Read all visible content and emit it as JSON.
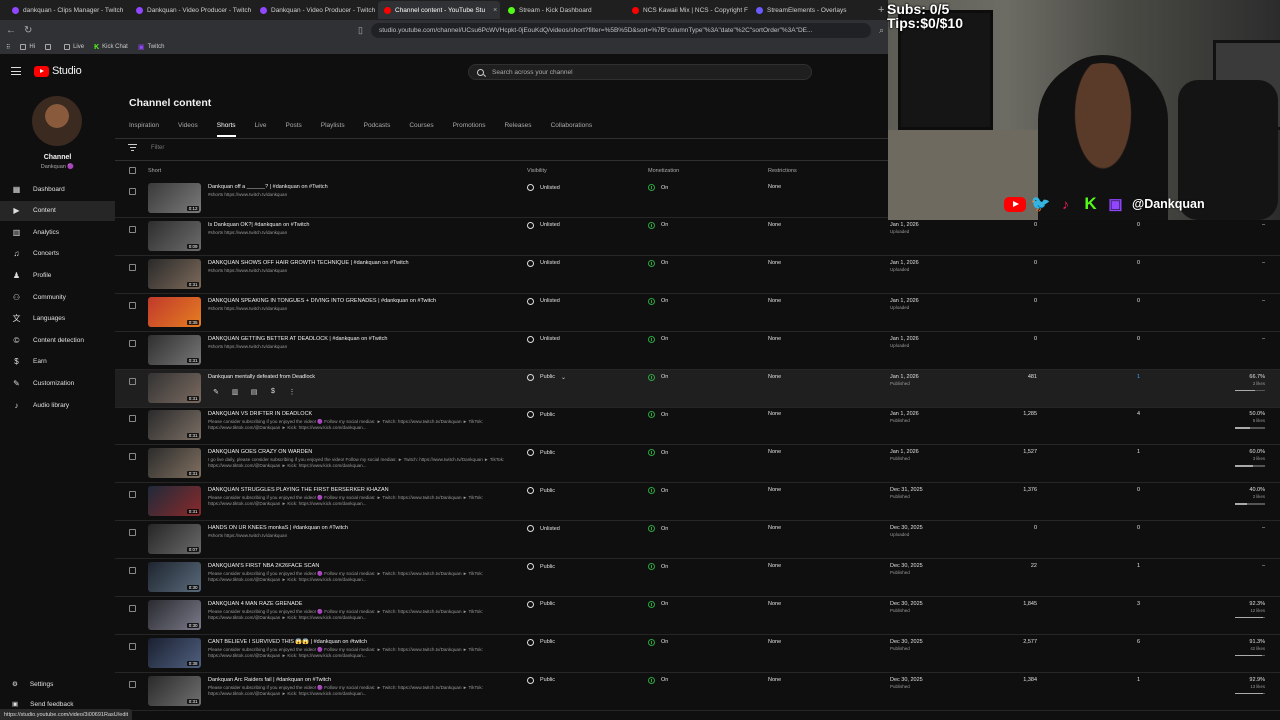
{
  "browser": {
    "tabs": [
      {
        "label": "dankquan - Clips Manager - Twitch",
        "color": "#9146ff",
        "active": false
      },
      {
        "label": "Dankquan - Video Producer - Twitch",
        "color": "#9146ff",
        "active": false
      },
      {
        "label": "Dankquan - Video Producer - Twitch",
        "color": "#9146ff",
        "active": false
      },
      {
        "label": "Channel content - YouTube Stu",
        "color": "#ff0000",
        "active": true
      },
      {
        "label": "Stream - Kick Dashboard",
        "color": "#53fc18",
        "active": false
      },
      {
        "label": "NCS Kawaii Mix | NCS - Copyright Fr",
        "color": "#ff0000",
        "active": false
      },
      {
        "label": "StreamElements - Overlays",
        "color": "#6b5bff",
        "active": false
      }
    ],
    "url": "studio.youtube.com/channel/UCsu6PcWVHcpkt-0jEouKdQ/videos/short?filter=%5B%5D&sort=%7B\"columnType\"%3A\"date\"%2C\"sortOrder\"%3A\"DE...",
    "bookmarks": [
      {
        "label": "Hi",
        "type": "folder"
      },
      {
        "label": "",
        "type": "folder"
      },
      {
        "label": "Live",
        "type": "folder"
      },
      {
        "label": "Kick Chat",
        "type": "kick"
      },
      {
        "label": "Twitch",
        "type": "twitch"
      }
    ],
    "status_url": "https://studio.youtube.com/video/3i00691RasU/edit"
  },
  "header": {
    "logo_text": "Studio",
    "search_placeholder": "Search across your channel"
  },
  "sidebar": {
    "channel_name": "Channel",
    "channel_handle": "Dankquan 🟣",
    "items": [
      {
        "label": "Dashboard",
        "icon": "dashboard-icon",
        "glyph": "▦",
        "active": false
      },
      {
        "label": "Content",
        "icon": "content-icon",
        "glyph": "▶",
        "active": true
      },
      {
        "label": "Analytics",
        "icon": "analytics-icon",
        "glyph": "▥",
        "active": false
      },
      {
        "label": "Concerts",
        "icon": "concerts-icon",
        "glyph": "♫",
        "active": false
      },
      {
        "label": "Profile",
        "icon": "profile-icon",
        "glyph": "♟",
        "active": false
      },
      {
        "label": "Community",
        "icon": "community-icon",
        "glyph": "⚇",
        "active": false
      },
      {
        "label": "Languages",
        "icon": "languages-icon",
        "glyph": "文",
        "active": false
      },
      {
        "label": "Content detection",
        "icon": "content-detection-icon",
        "glyph": "©",
        "active": false
      },
      {
        "label": "Earn",
        "icon": "earn-icon",
        "glyph": "$",
        "active": false
      },
      {
        "label": "Customization",
        "icon": "customization-icon",
        "glyph": "✎",
        "active": false
      },
      {
        "label": "Audio library",
        "icon": "audio-library-icon",
        "glyph": "♪",
        "active": false
      }
    ],
    "settings_label": "Settings",
    "feedback_label": "Send feedback"
  },
  "main": {
    "title": "Channel content",
    "tabs": [
      {
        "label": "Inspiration",
        "active": false
      },
      {
        "label": "Videos",
        "active": false
      },
      {
        "label": "Shorts",
        "active": true
      },
      {
        "label": "Live",
        "active": false
      },
      {
        "label": "Posts",
        "active": false
      },
      {
        "label": "Playlists",
        "active": false
      },
      {
        "label": "Podcasts",
        "active": false
      },
      {
        "label": "Courses",
        "active": false
      },
      {
        "label": "Promotions",
        "active": false
      },
      {
        "label": "Releases",
        "active": false
      },
      {
        "label": "Collaborations",
        "active": false
      }
    ],
    "filter_placeholder": "Filter",
    "columns": {
      "short": "Short",
      "visibility": "Visibility",
      "monetization": "Monetization",
      "restrictions": "Restrictions"
    },
    "rows": [
      {
        "title": "Dankquan off a ______? | #dankquan on #Twitch",
        "desc": "#shorts https://www.twitch.tv/dankquan",
        "duration": "0:12",
        "visibility": "Unlisted",
        "vis_icon": "link-icon",
        "monetization": "On",
        "restrictions": "None",
        "date": "",
        "status": "",
        "views": "",
        "comments": "",
        "likes": "",
        "likes_sub": "",
        "like_ratio": null,
        "thumb": [
          "#3a3a3a",
          "#7a7a7a"
        ]
      },
      {
        "title": "Is Dankquan OK?| #dankquan on #Twitch",
        "desc": "#shorts https://www.twitch.tv/dankquan",
        "duration": "0:09",
        "visibility": "Unlisted",
        "vis_icon": "link-icon",
        "monetization": "On",
        "restrictions": "None",
        "date": "Jan 1, 2026",
        "status": "Uploaded",
        "views": "0",
        "comments": "0",
        "likes": "–",
        "likes_sub": "",
        "like_ratio": null,
        "thumb": [
          "#2e2e2e",
          "#6c6c6c"
        ]
      },
      {
        "title": "DANKQUAN SHOWS OFF HAIR GROWTH TECHNIQUE | #dankquan on #Twitch",
        "desc": "#shorts https://www.twitch.tv/dankquan",
        "duration": "0:31",
        "visibility": "Unlisted",
        "vis_icon": "link-icon",
        "monetization": "On",
        "restrictions": "None",
        "date": "Jan 1, 2026",
        "status": "Uploaded",
        "views": "0",
        "comments": "0",
        "likes": "–",
        "likes_sub": "",
        "like_ratio": null,
        "thumb": [
          "#2a2a2a",
          "#7d6a5a"
        ]
      },
      {
        "title": "DANKQUAN SPEAKING IN TONGUES + DIVING INTO GRENADES | #dankquan on #Twitch",
        "desc": "#shorts https://www.twitch.tv/dankquan",
        "duration": "0:35",
        "visibility": "Unlisted",
        "vis_icon": "link-icon",
        "monetization": "On",
        "restrictions": "None",
        "date": "Jan 1, 2026",
        "status": "Uploaded",
        "views": "0",
        "comments": "0",
        "likes": "–",
        "likes_sub": "",
        "like_ratio": null,
        "thumb": [
          "#c0392b",
          "#e67e22"
        ]
      },
      {
        "title": "DANKQUAN GETTING BETTER AT DEADLOCK | #dankquan on #Twitch",
        "desc": "#shorts https://www.twitch.tv/dankquan",
        "duration": "0:31",
        "visibility": "Unlisted",
        "vis_icon": "link-icon",
        "monetization": "On",
        "restrictions": "None",
        "date": "Jan 1, 2026",
        "status": "Uploaded",
        "views": "0",
        "comments": "0",
        "likes": "–",
        "likes_sub": "",
        "like_ratio": null,
        "thumb": [
          "#2f2f2f",
          "#777"
        ]
      },
      {
        "title": "Dankquan mentally defeated from Deadlock",
        "desc": "",
        "duration": "0:31",
        "visibility": "Public",
        "vis_icon": "globe-icon",
        "monetization": "On",
        "restrictions": "None",
        "date": "Jan 1, 2026",
        "status": "Published",
        "views": "481",
        "comments": "1",
        "comments_link": true,
        "likes": "66.7%",
        "likes_sub": "2 likes",
        "like_ratio": 0.667,
        "thumb": [
          "#333",
          "#7a6a60"
        ],
        "hover": true
      },
      {
        "title": "DANKQUAN VS DRIFTER IN DEADLOCK",
        "desc": "Please consider subscribing if you enjoyed the video! 🟣 Follow my social medias: ► Twitch: https://www.twitch.tv/Dankquan ► TikTok: https://www.tiktok.com/@Dankquan ► Kick: https://www.kick.com/dankquan...",
        "duration": "0:31",
        "visibility": "Public",
        "vis_icon": "globe-icon",
        "monetization": "On",
        "restrictions": "None",
        "date": "Jan 1, 2026",
        "status": "Published",
        "views": "1,285",
        "comments": "4",
        "likes": "50.0%",
        "likes_sub": "5 likes",
        "like_ratio": 0.5,
        "thumb": [
          "#2b2b2b",
          "#7b6e64"
        ]
      },
      {
        "title": "DANKQUAN GOES CRAZY ON WARDEN",
        "desc": "I go live daily, please consider subscribing if you enjoyed the video! Follow my social medias: ► Twitch: https://www.twitch.tv/Dankquan ► TikTok: https://www.tiktok.com/@Dankquan ► Kick: https://www.kick.com/dankquan...",
        "duration": "0:31",
        "visibility": "Public",
        "vis_icon": "globe-icon",
        "monetization": "On",
        "restrictions": "None",
        "date": "Jan 1, 2026",
        "status": "Published",
        "views": "1,527",
        "comments": "1",
        "likes": "60.0%",
        "likes_sub": "3 likes",
        "like_ratio": 0.6,
        "thumb": [
          "#2c2c2c",
          "#807060"
        ]
      },
      {
        "title": "DANKQUAN STRUGGLES PLAYING THE FIRST BERSERKER KHAZAN",
        "desc": "Please consider subscribing if you enjoyed the video! 🟣 Follow my social medias: ► Twitch: https://www.twitch.tv/Dankquan ► TikTok: https://www.tiktok.com/@Dankquan ► Kick: https://www.kick.com/dankquan...",
        "duration": "0:31",
        "visibility": "Public",
        "vis_icon": "globe-icon",
        "monetization": "On",
        "restrictions": "None",
        "date": "Dec 31, 2025",
        "status": "Published",
        "views": "1,376",
        "comments": "0",
        "likes": "40.0%",
        "likes_sub": "2 likes",
        "like_ratio": 0.4,
        "thumb": [
          "#1f2a3a",
          "#8a2a2a"
        ]
      },
      {
        "title": "HANDS ON UR KNEES monkaS | #dankquan on #Twitch",
        "desc": "#shorts https://www.twitch.tv/dankquan",
        "duration": "0:07",
        "visibility": "Unlisted",
        "vis_icon": "link-icon",
        "monetization": "On",
        "restrictions": "None",
        "date": "Dec 30, 2025",
        "status": "Uploaded",
        "views": "0",
        "comments": "0",
        "likes": "–",
        "likes_sub": "",
        "like_ratio": null,
        "thumb": [
          "#262626",
          "#6a6a6a"
        ]
      },
      {
        "title": "DANKQUAN'S FIRST NBA 2K26FACE SCAN",
        "desc": "Please consider subscribing if you enjoyed the video! 🟣 Follow my social medias: ► Twitch: https://www.twitch.tv/Dankquan ► TikTok: https://www.tiktok.com/@Dankquan ► Kick: https://www.kick.com/dankquan...",
        "duration": "0:30",
        "visibility": "Public",
        "vis_icon": "globe-icon",
        "monetization": "On",
        "restrictions": "None",
        "date": "Dec 30, 2025",
        "status": "Published",
        "views": "22",
        "comments": "1",
        "likes": "–",
        "likes_sub": "",
        "like_ratio": null,
        "thumb": [
          "#1e2530",
          "#5a6a7a"
        ]
      },
      {
        "title": "DANKQUAN 4 MAN RAZE GRENADE",
        "desc": "Please consider subscribing if you enjoyed the video! 🟣 Follow my social medias: ► Twitch: https://www.twitch.tv/Dankquan ► TikTok: https://www.tiktok.com/@Dankquan ► Kick: https://www.kick.com/dankquan...",
        "duration": "0:30",
        "visibility": "Public",
        "vis_icon": "globe-icon",
        "monetization": "On",
        "restrictions": "None",
        "date": "Dec 30, 2025",
        "status": "Published",
        "views": "1,845",
        "comments": "3",
        "likes": "92.3%",
        "likes_sub": "12 likes",
        "like_ratio": 0.923,
        "thumb": [
          "#2a2a30",
          "#7a7a8a"
        ]
      },
      {
        "title": "CANT BELIEVE I SURVIVED THIS 😱😱 | #dankquan on #twitch",
        "desc": "Please consider subscribing if you enjoyed the video! 🟣 Follow my social medias: ► Twitch: https://www.twitch.tv/Dankquan ► TikTok: https://www.tiktok.com/@Dankquan ► Kick: https://www.kick.com/dankquan...",
        "duration": "0:38",
        "visibility": "Public",
        "vis_icon": "globe-icon",
        "monetization": "On",
        "restrictions": "None",
        "date": "Dec 30, 2025",
        "status": "Published",
        "views": "2,577",
        "comments": "6",
        "likes": "91.3%",
        "likes_sub": "42 likes",
        "like_ratio": 0.913,
        "thumb": [
          "#1a2030",
          "#506080"
        ]
      },
      {
        "title": "Dankquan Arc Raiders fail | #dankquan on #Twitch",
        "desc": "Please consider subscribing if you enjoyed the video! 🟣 Follow my social medias: ► Twitch: https://www.twitch.tv/Dankquan ► TikTok: https://www.tiktok.com/@Dankquan ► Kick: https://www.kick.com/dankquan...",
        "duration": "0:31",
        "visibility": "Public",
        "vis_icon": "globe-icon",
        "monetization": "On",
        "restrictions": "None",
        "date": "Dec 30, 2025",
        "status": "Published",
        "views": "1,384",
        "comments": "1",
        "likes": "92.9%",
        "likes_sub": "13 likes",
        "like_ratio": 0.929,
        "thumb": [
          "#2a2a2a",
          "#707070"
        ]
      }
    ]
  },
  "overlay": {
    "subs": "Subs: 0/5",
    "tips": "Tips:$0/$10",
    "handle": "@Dankquan"
  },
  "colors": {
    "accent": "#3ea6ff",
    "monetization_on": "#2ba640",
    "youtube_red": "#ff0000"
  }
}
